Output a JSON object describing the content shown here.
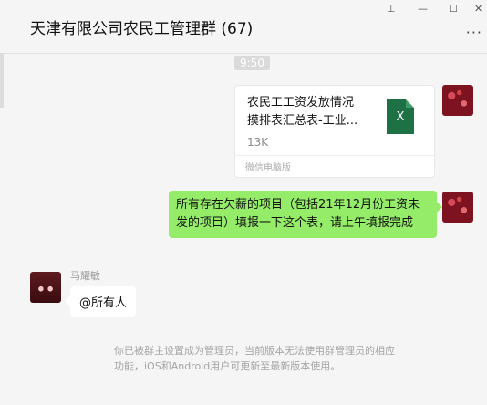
{
  "window": {
    "title": "天津有限公司农民工管理群 (67)",
    "controls": {
      "pin": "⊥",
      "minimize": "—",
      "maximize": "☐",
      "close": "✕"
    },
    "more": "···"
  },
  "chat": {
    "timestamp": "9:50",
    "file_message": {
      "line1": "农民工工资发放情况",
      "line2": "摸排表汇总表-工业...",
      "size": "13K",
      "source": "微信电脑版",
      "icon_letter": "X"
    },
    "text_message": "所有存在欠薪的项目（包括21年12月份工资未发的项目）填报一下这个表，请上午填报完成",
    "other_sender": "马耀敏",
    "other_message": "@所有人",
    "system_note": "你已被群主设置成为管理员，当前版本无法使用群管理员的相应功能，iOS和Android用户可更新至最新版本使用。"
  }
}
